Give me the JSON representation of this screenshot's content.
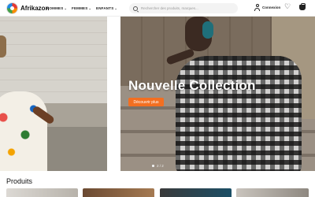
{
  "header": {
    "brand": "Afrikazon",
    "nav": [
      {
        "label": "HOMMES",
        "chevron": "⌄"
      },
      {
        "label": "FEMMES",
        "chevron": "⌄"
      },
      {
        "label": "ENFANTS",
        "chevron": "⌄"
      }
    ],
    "search_placeholder": "Rechercher des produits, marques...",
    "login_label": "Connexion",
    "icons": [
      "logo",
      "search-icon",
      "user-icon",
      "heart-icon",
      "cart-icon"
    ]
  },
  "hero": {
    "title": "Nouvelle Collection",
    "cta_label": "Découvrir plus",
    "pager_label": "2 / 2",
    "accent_color": "#f36f21"
  },
  "products": {
    "title": "Produits"
  }
}
